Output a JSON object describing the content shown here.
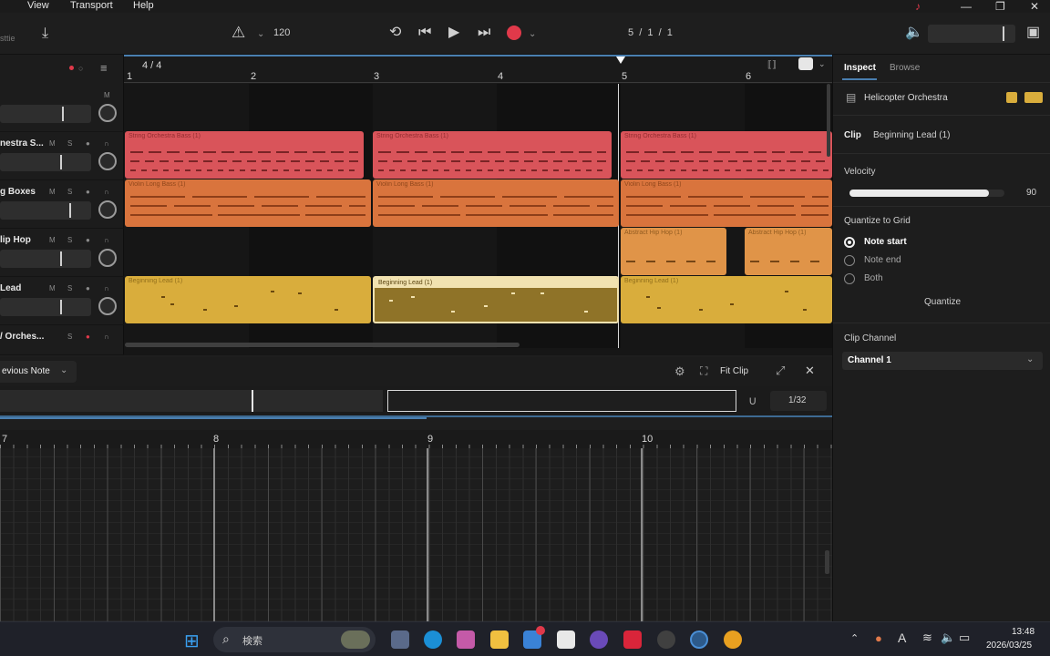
{
  "menu": {
    "view": "View",
    "transport": "Transport",
    "help": "Help"
  },
  "toolbar": {
    "tempo": "120",
    "position": "5  /  1  /  1"
  },
  "arrange": {
    "time_signature": "4 / 4",
    "bars": [
      "1",
      "2",
      "3",
      "4",
      "5",
      "6"
    ],
    "tracks": [
      {
        "name": ""
      },
      {
        "name": "nestra S..."
      },
      {
        "name": "g Boxes"
      },
      {
        "name": "lip Hop"
      },
      {
        "name": "Lead"
      },
      {
        "name": "/ Orches..."
      }
    ],
    "clips": {
      "strings": "String Orchestra Bass (1)",
      "violin": "Violin Long Bass (1)",
      "hiphop": "Abstract Hip Hop (1)",
      "lead": "Beginning Lead (1)"
    }
  },
  "inspector": {
    "tab_inspect": "Inspect",
    "tab_browse": "Browse",
    "instrument": "Helicopter Orchestra",
    "clip_label": "Clip",
    "clip_name": "Beginning Lead (1)",
    "velocity_label": "Velocity",
    "velocity_value": "90",
    "velocity_fraction": 0.9,
    "quantize_label": "Quantize to Grid",
    "options": [
      "Note start",
      "Note end",
      "Both"
    ],
    "selected_option": "Note start",
    "quantize_button": "Quantize",
    "channel_label": "Clip Channel",
    "channel_value": "Channel 1"
  },
  "editor": {
    "prev_note": "evious Note",
    "fit_clip": "Fit Clip",
    "grid": "1/32",
    "bars": [
      "7",
      "8",
      "9",
      "10"
    ]
  },
  "taskbar": {
    "search": "検索",
    "time": "13:48",
    "date": "2026/03/25"
  },
  "colors": {
    "strings_clip": "#d9545a",
    "violin_clip": "#d9743d",
    "hiphop_clip": "#e09448",
    "lead_clip": "#d9ad3c",
    "lead_selected": "#8f7328",
    "accent_blue": "#4a7fb0",
    "record_red": "#e0394a"
  }
}
